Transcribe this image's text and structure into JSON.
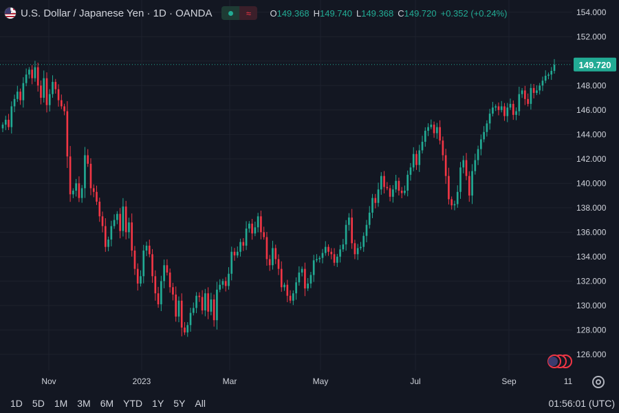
{
  "header": {
    "symbol_title": "U.S. Dollar / Japanese Yen · 1D · OANDA",
    "flag_icon": "usd-jpy-flag-icon",
    "status_icon": "market-status-dot-icon",
    "wave_icon": "wave-icon",
    "ohlc": {
      "o_label": "O",
      "o_value": "149.368",
      "h_label": "H",
      "h_value": "149.740",
      "l_label": "L",
      "l_value": "149.368",
      "c_label": "C",
      "c_value": "149.720",
      "change": "+0.352 (+0.24%)"
    }
  },
  "colors": {
    "background": "#131722",
    "grid": "#1e222d",
    "up": "#22ab94",
    "down": "#f23645",
    "text": "#d1d4dc"
  },
  "bottombar": {
    "ranges": [
      "1D",
      "5D",
      "1M",
      "3M",
      "6M",
      "YTD",
      "1Y",
      "5Y",
      "All"
    ],
    "clock": "01:56:01 (UTC)"
  },
  "chart_data": {
    "type": "candlestick",
    "title": "U.S. Dollar / Japanese Yen · 1D · OANDA",
    "y_ticks": [
      "154.000",
      "152.000",
      "150.000",
      "148.000",
      "146.000",
      "144.000",
      "142.000",
      "140.000",
      "138.000",
      "136.000",
      "134.000",
      "132.000",
      "130.000",
      "128.000",
      "126.000"
    ],
    "x_ticks": [
      "Nov",
      "2023",
      "Mar",
      "May",
      "Jul",
      "Sep",
      "11"
    ],
    "ylim": [
      124.7,
      155
    ],
    "last_price_label": "149.720",
    "grid": true,
    "closes": [
      144.8,
      145.2,
      144.6,
      146.3,
      146.9,
      147.5,
      146.8,
      148.2,
      148.9,
      149.3,
      148.6,
      149.5,
      148.0,
      147.0,
      148.6,
      146.4,
      147.3,
      148.3,
      147.7,
      146.8,
      146.3,
      145.9,
      142.2,
      139.1,
      139.4,
      140.0,
      138.8,
      139.6,
      142.3,
      141.6,
      139.6,
      139.3,
      138.5,
      137.3,
      136.5,
      134.8,
      135.4,
      136.5,
      137.0,
      137.5,
      136.1,
      138.1,
      136.0,
      136.8,
      134.5,
      133.0,
      131.8,
      132.4,
      134.5,
      134.9,
      134.2,
      132.4,
      131.0,
      130.1,
      132.0,
      133.3,
      132.7,
      131.5,
      130.9,
      129.1,
      130.4,
      128.2,
      127.8,
      128.4,
      129.4,
      129.8,
      130.8,
      130.7,
      129.6,
      131.0,
      129.5,
      130.5,
      128.8,
      131.3,
      131.7,
      132.0,
      131.6,
      132.6,
      134.4,
      134.1,
      134.4,
      135.2,
      134.9,
      136.3,
      136.7,
      135.9,
      136.4,
      137.3,
      136.0,
      135.6,
      133.8,
      133.3,
      134.7,
      133.8,
      133.0,
      131.5,
      131.7,
      130.8,
      130.4,
      131.0,
      131.9,
      132.7,
      133.0,
      131.4,
      131.8,
      132.5,
      133.7,
      133.8,
      133.9,
      134.3,
      134.8,
      134.4,
      134.2,
      133.5,
      134.0,
      134.6,
      135.0,
      136.6,
      137.2,
      135.1,
      134.2,
      134.7,
      134.8,
      135.7,
      136.6,
      137.6,
      138.8,
      138.4,
      139.5,
      140.6,
      139.7,
      139.6,
      138.9,
      139.5,
      140.2,
      139.4,
      139.2,
      139.4,
      140.7,
      141.3,
      142.4,
      141.5,
      142.7,
      143.4,
      144.3,
      144.6,
      144.8,
      144.1,
      144.6,
      143.5,
      142.3,
      140.6,
      138.7,
      138.2,
      138.3,
      139.3,
      141.3,
      141.9,
      140.6,
      139.0,
      141.0,
      141.9,
      142.8,
      143.6,
      144.2,
      144.9,
      145.7,
      146.2,
      146.3,
      146.0,
      146.3,
      145.5,
      146.2,
      146.5,
      145.6,
      145.9,
      147.3,
      147.6,
      146.9,
      146.5,
      147.8,
      147.4,
      147.6,
      148.0,
      148.4,
      148.8,
      148.9,
      149.2,
      149.7
    ]
  }
}
